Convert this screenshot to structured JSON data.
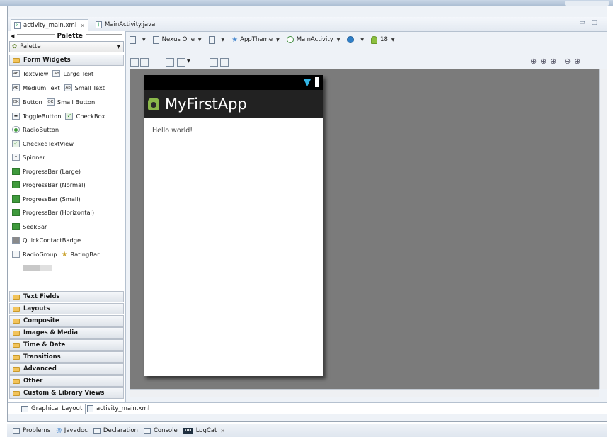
{
  "editor_tabs": [
    {
      "label": "activity_main.xml",
      "active": true
    },
    {
      "label": "MainActivity.java",
      "active": false
    }
  ],
  "palette": {
    "header": "Palette",
    "selector": "Palette",
    "open_category": "Form Widgets",
    "widgets": [
      [
        "TextView",
        "Large Text"
      ],
      [
        "Medium Text",
        "Small Text"
      ],
      [
        "Button",
        "Small Button"
      ],
      [
        "ToggleButton",
        "CheckBox"
      ],
      [
        "RadioButton"
      ],
      [
        "CheckedTextView"
      ],
      [
        "Spinner"
      ],
      [
        "ProgressBar (Large)"
      ],
      [
        "ProgressBar (Normal)"
      ],
      [
        "ProgressBar (Small)"
      ],
      [
        "ProgressBar (Horizontal)"
      ],
      [
        "SeekBar"
      ],
      [
        "QuickContactBadge"
      ],
      [
        "RadioGroup",
        "RatingBar"
      ]
    ],
    "categories": [
      "Text Fields",
      "Layouts",
      "Composite",
      "Images & Media",
      "Time & Date",
      "Transitions",
      "Advanced",
      "Other",
      "Custom & Library Views"
    ]
  },
  "toolbar": {
    "device": "Nexus One",
    "theme": "AppTheme",
    "activity": "MainActivity",
    "api": "18"
  },
  "preview": {
    "app_title": "MyFirstApp",
    "content_text": "Hello world!"
  },
  "bottom_tabs": [
    {
      "label": "Graphical Layout",
      "active": true
    },
    {
      "label": "activity_main.xml",
      "active": false
    }
  ],
  "views": [
    "Problems",
    "Javadoc",
    "Declaration",
    "Console",
    "LogCat"
  ],
  "colors": {
    "action_bar": "#222222",
    "status_bar": "#000000",
    "canvas": "#7b7b7b",
    "holo_blue": "#33b5e5"
  }
}
